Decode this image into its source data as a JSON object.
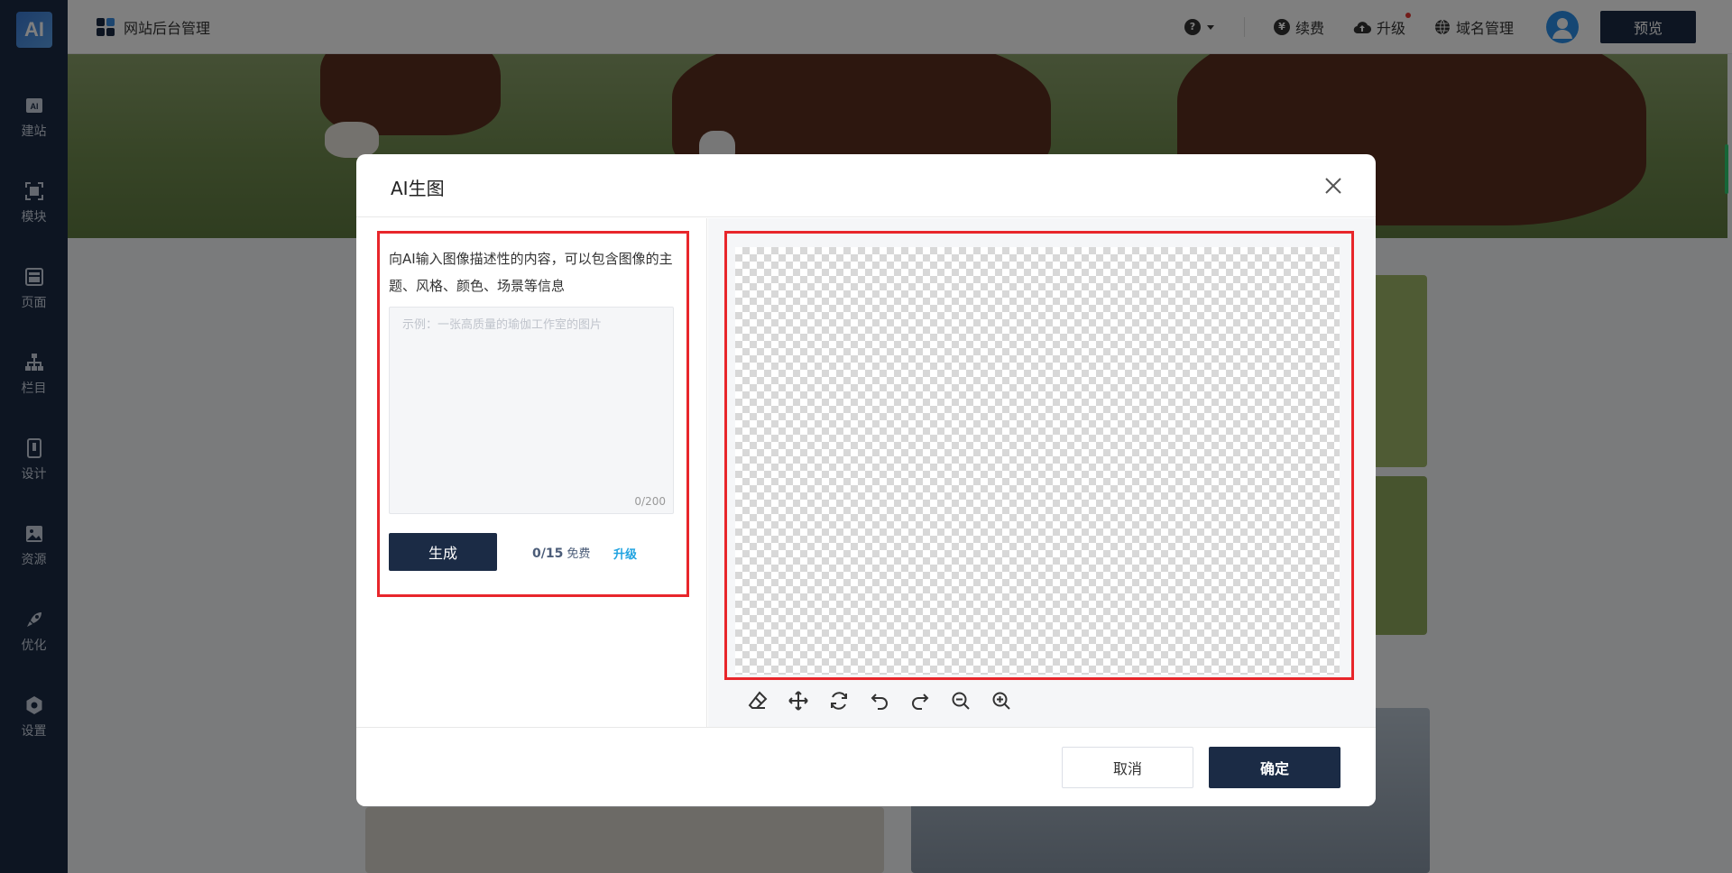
{
  "app": {
    "logo_text": "AI",
    "title": "网站后台管理"
  },
  "sidebar": {
    "items": [
      {
        "label": "建站",
        "icon": "ai-site-icon"
      },
      {
        "label": "模块",
        "icon": "module-icon"
      },
      {
        "label": "页面",
        "icon": "page-icon"
      },
      {
        "label": "栏目",
        "icon": "sitemap-icon"
      },
      {
        "label": "设计",
        "icon": "design-icon"
      },
      {
        "label": "资源",
        "icon": "image-icon"
      },
      {
        "label": "优化",
        "icon": "rocket-icon"
      },
      {
        "label": "设置",
        "icon": "gear-icon"
      }
    ]
  },
  "topbar": {
    "help_icon_text": "?",
    "renew_label": "续费",
    "renew_icon_text": "¥",
    "upgrade_label": "升级",
    "domain_label": "域名管理",
    "preview_label": "预览"
  },
  "modal": {
    "title": "AI生图",
    "hint": "向AI输入图像描述性的内容，可以包含图像的主题、风格、颜色、场景等信息",
    "prompt_placeholder": "示例：一张高质量的瑜伽工作室的图片",
    "prompt_value": "",
    "counter": "0/200",
    "generate_label": "生成",
    "quota_count": "0/15",
    "quota_free": "免费",
    "upgrade_label": "升级",
    "cancel_label": "取消",
    "ok_label": "确定"
  },
  "colors": {
    "sidebar": "#1b2b45",
    "primary": "#1b2b45",
    "highlight_border": "#e8262b",
    "link": "#1ea2e0"
  }
}
